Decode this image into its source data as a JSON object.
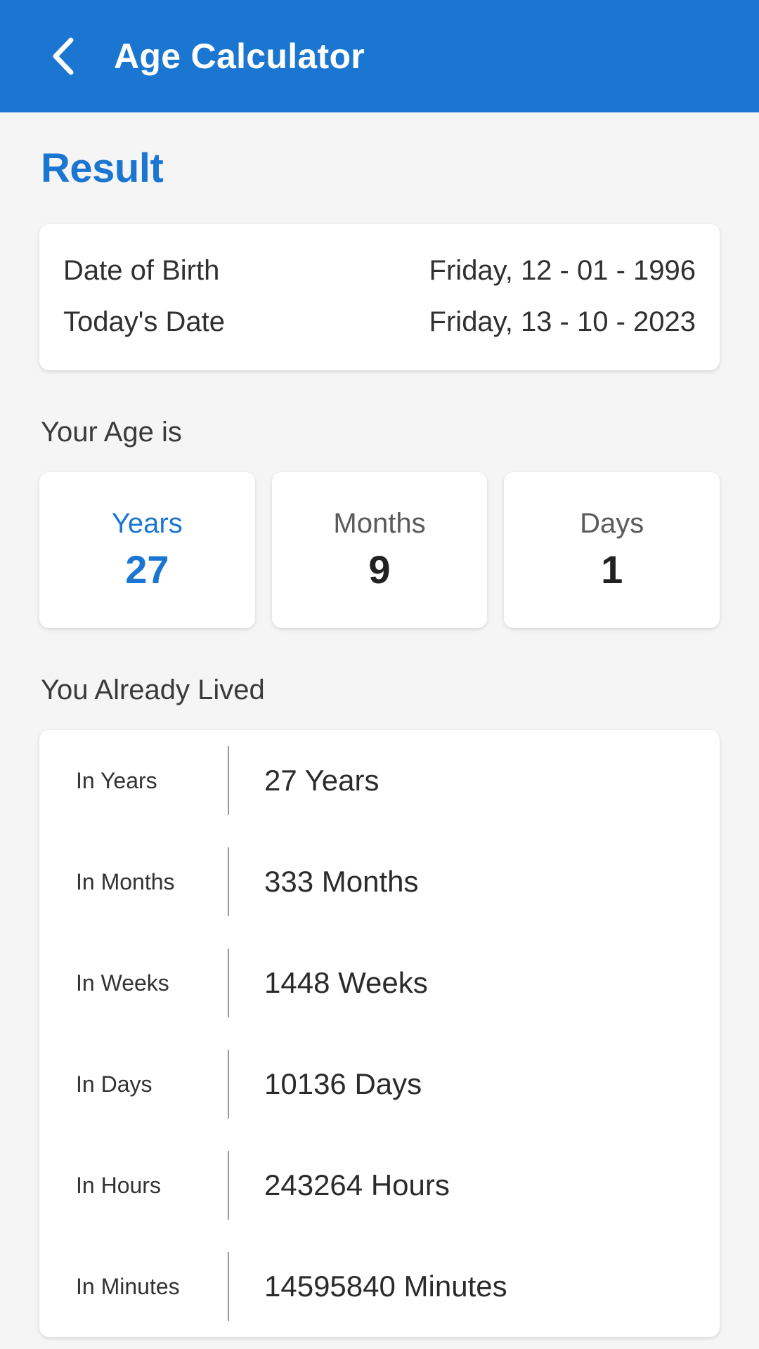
{
  "appbar": {
    "back_icon": "chevron-left-icon",
    "title": "Age Calculator"
  },
  "page": {
    "result_heading": "Result"
  },
  "dates": {
    "rows": [
      {
        "label": "Date of Birth",
        "value": "Friday, 12 - 01 - 1996"
      },
      {
        "label": "Today's Date",
        "value": "Friday, 13 - 10 - 2023"
      }
    ]
  },
  "age": {
    "section_label": "Your Age is",
    "cards": [
      {
        "label": "Years",
        "value": "27",
        "accent": true
      },
      {
        "label": "Months",
        "value": "9",
        "accent": false
      },
      {
        "label": "Days",
        "value": "1",
        "accent": false
      }
    ]
  },
  "lived": {
    "section_label": "You Already Lived",
    "rows": [
      {
        "label": "In Years",
        "value": "27 Years"
      },
      {
        "label": "In Months",
        "value": "333 Months"
      },
      {
        "label": "In Weeks",
        "value": "1448 Weeks"
      },
      {
        "label": "In Days",
        "value": "10136 Days"
      },
      {
        "label": "In Hours",
        "value": "243264 Hours"
      },
      {
        "label": "In Minutes",
        "value": "14595840 Minutes"
      }
    ]
  },
  "colors": {
    "accent": "#1b76d2",
    "background": "#f5f5f5",
    "card": "#ffffff",
    "text_primary": "#303030",
    "text_secondary": "#5a5a5a"
  }
}
